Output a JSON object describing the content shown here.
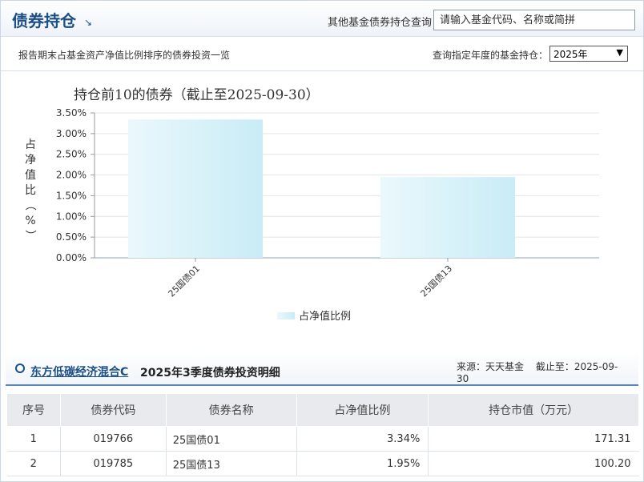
{
  "header": {
    "title": "债券持仓",
    "search_label": "其他基金债券持仓查询：",
    "search_placeholder": "请输入基金代码、名称或简拼"
  },
  "subbar": {
    "description": "报告期末占基金资产净值比例排序的债券投资一览",
    "year_label": "查询指定年度的基金持仓：",
    "year_value": "2025年"
  },
  "chart_data": {
    "type": "bar",
    "title": "持仓前10的债券（截止至2025-09-30）",
    "ylabel": "占净值比（%）",
    "ylim": [
      0,
      3.5
    ],
    "yticks": [
      "0.00%",
      "0.50%",
      "1.00%",
      "1.50%",
      "2.00%",
      "2.50%",
      "3.00%",
      "3.50%"
    ],
    "categories": [
      "25国债01",
      "25国债13"
    ],
    "series": [
      {
        "name": "占净值比例",
        "values": [
          3.34,
          1.95
        ]
      }
    ],
    "grid": true,
    "legend": "bottom-center",
    "bar_color": "#c9ecf6"
  },
  "detail": {
    "fund_name": "东方低碳经济混合C",
    "title": "2025年3季度债券投资明细",
    "source": "来源：天天基金",
    "as_of": "截止至：2025-09-30"
  },
  "table": {
    "headers": [
      "序号",
      "债券代码",
      "债券名称",
      "占净值比例",
      "持仓市值（万元）"
    ],
    "rows": [
      [
        "1",
        "019766",
        "25国债01",
        "3.34%",
        "171.31"
      ],
      [
        "2",
        "019785",
        "25国债13",
        "1.95%",
        "100.20"
      ]
    ]
  }
}
